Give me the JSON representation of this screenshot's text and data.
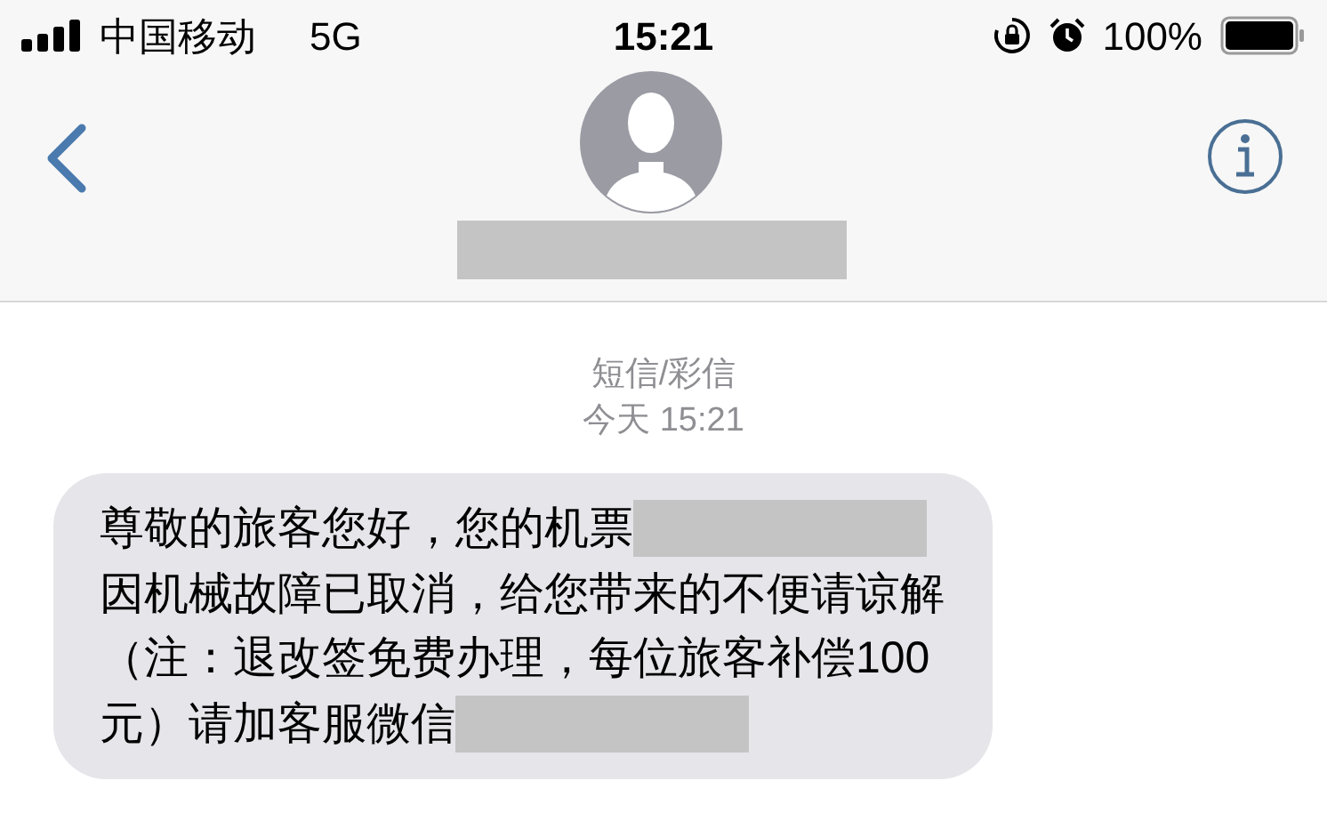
{
  "status_bar": {
    "carrier": "中国移动",
    "network": "5G",
    "time": "15:21",
    "battery": "100%"
  },
  "header": {
    "contact_redacted": true
  },
  "conversation": {
    "service": "短信/彩信",
    "timestamp": "今天 15:21"
  },
  "message": {
    "lines": [
      [
        {
          "kind": "text",
          "text": "尊敬的旅客您好，您的机票"
        },
        {
          "kind": "redaction"
        }
      ],
      [
        {
          "kind": "text",
          "text": "因机械故障已取消，给您带来的不便请谅解"
        }
      ],
      [
        {
          "kind": "text",
          "text": "（注：退改签免费办理，每位旅客补偿100"
        }
      ],
      [
        {
          "kind": "text",
          "text": "元）请加客服微信"
        },
        {
          "kind": "redaction"
        }
      ]
    ]
  }
}
